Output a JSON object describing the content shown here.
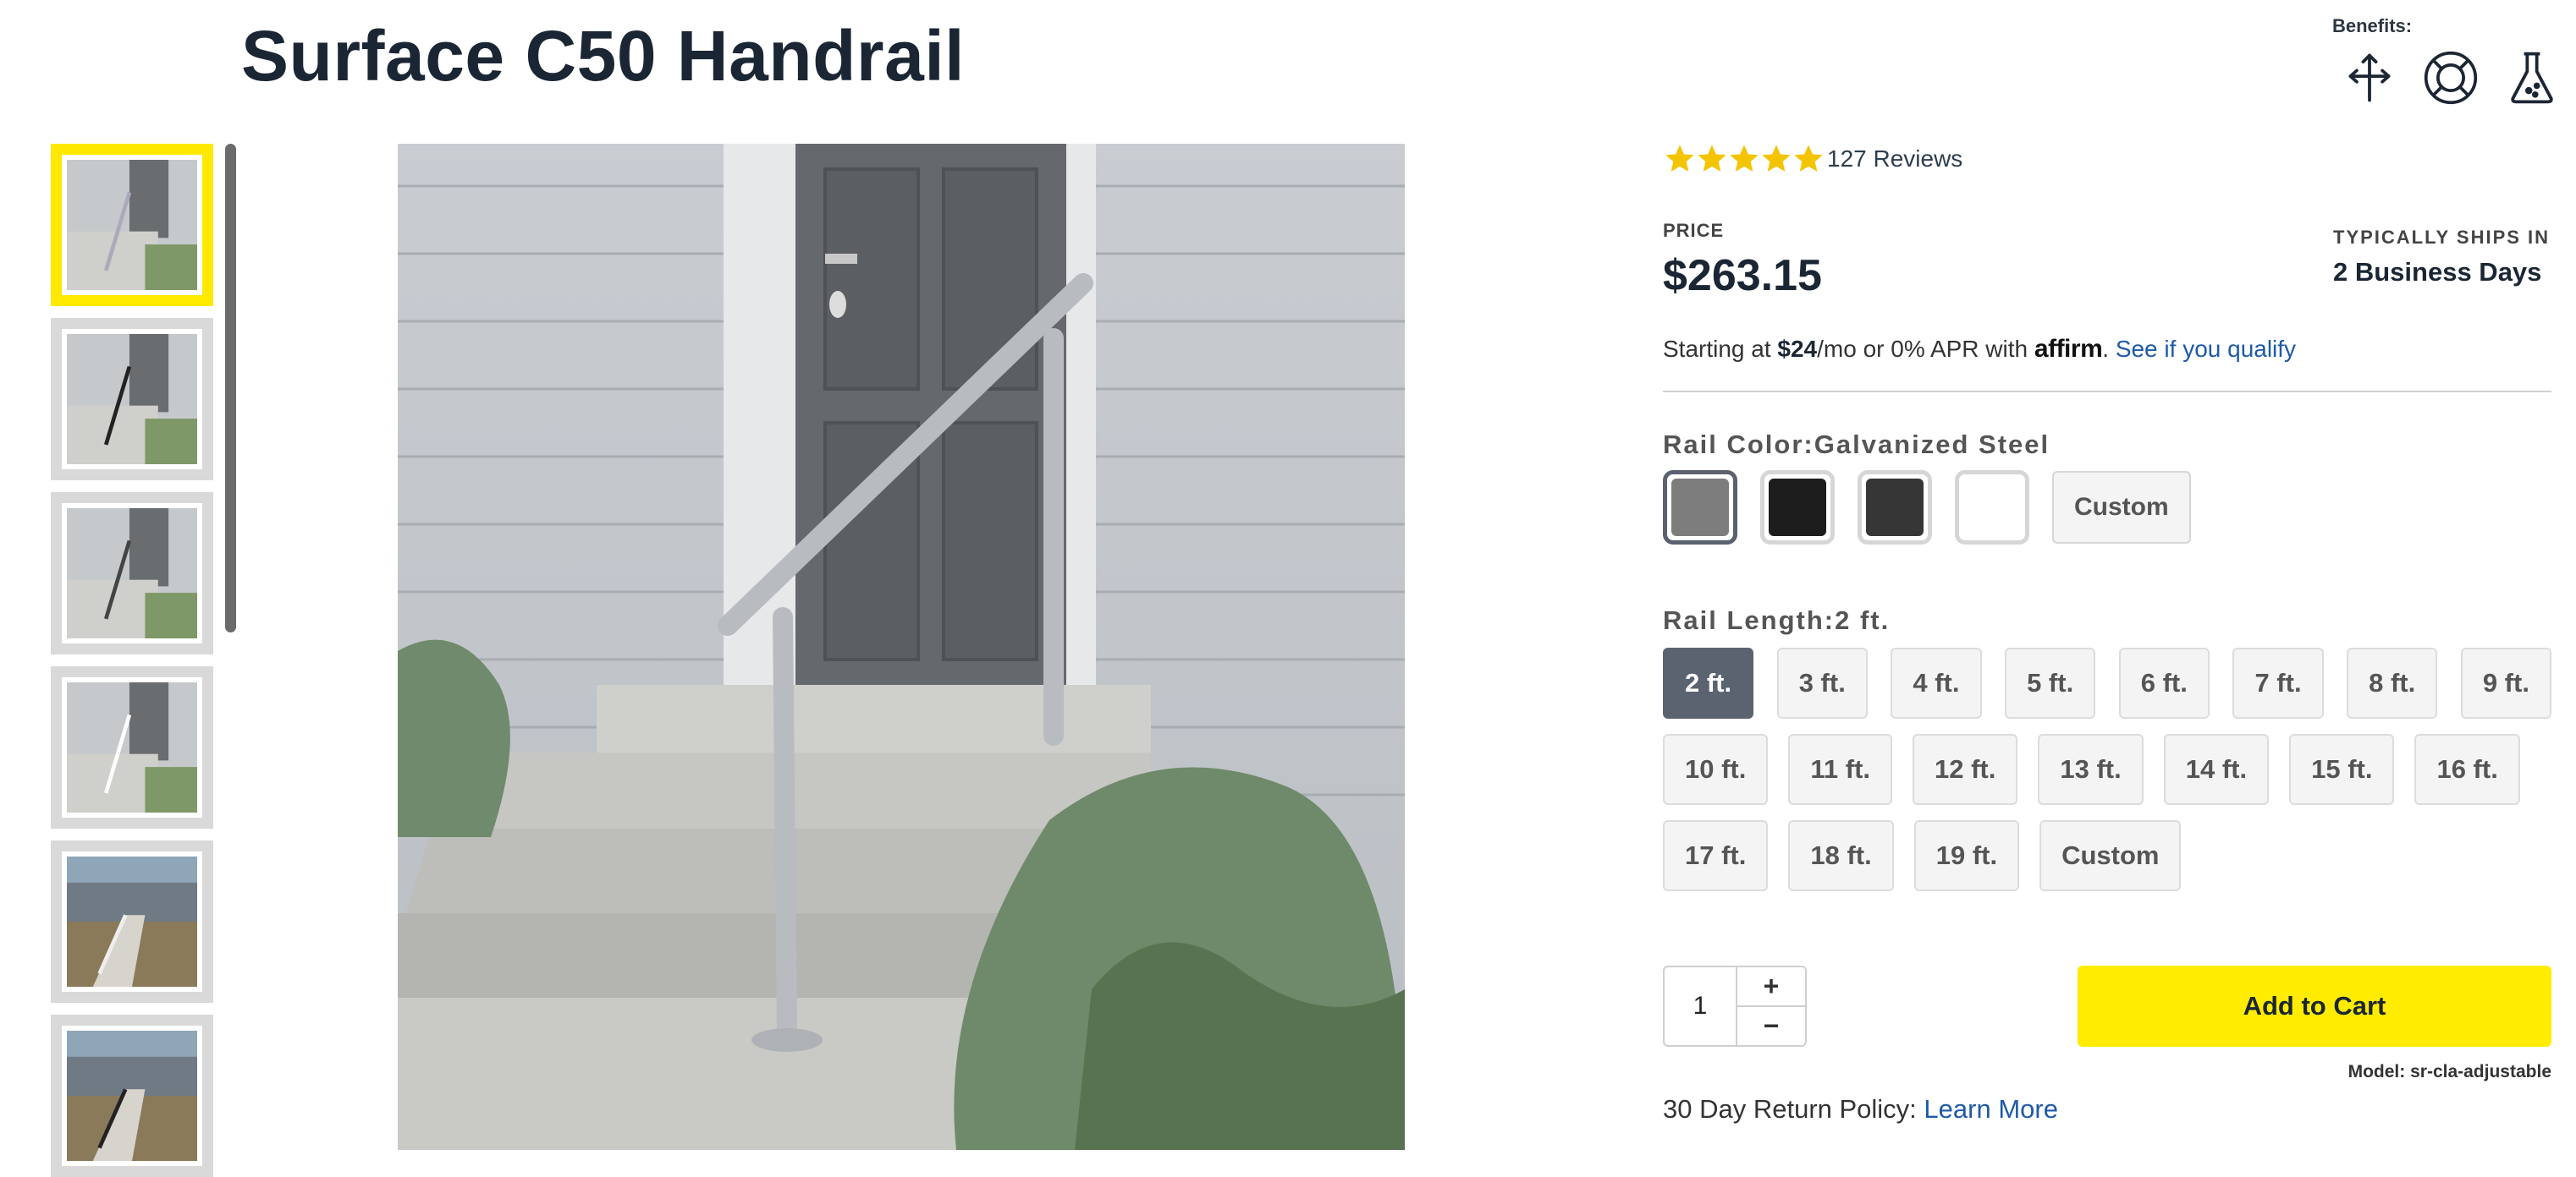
{
  "product": {
    "title": "Surface C50 Handrail"
  },
  "benefits": {
    "label": "Benefits:",
    "icons": [
      "adjustable-arrows-icon",
      "lifebuoy-icon",
      "flask-icon"
    ]
  },
  "gallery": {
    "thumbnail_count": 6,
    "selected_index": 0
  },
  "rating": {
    "stars": 5,
    "reviews_label": "127 Reviews"
  },
  "price": {
    "label": "PRICE",
    "value": "$263.15"
  },
  "shipping": {
    "label": "TYPICALLY SHIPS IN",
    "value": "2 Business Days"
  },
  "financing": {
    "prefix": "Starting at ",
    "amount": "$24",
    "suffix": "/mo or 0% APR with ",
    "brand": "affirm",
    "period": ".",
    "link": "See if you qualify"
  },
  "rail_color": {
    "label": "Rail Color:",
    "selected": "Galvanized Steel",
    "swatches": [
      {
        "color": "#7d7d7d",
        "selected": true
      },
      {
        "color": "#1d1d1d",
        "selected": false
      },
      {
        "color": "#363636",
        "selected": false
      },
      {
        "color": "#ffffff",
        "selected": false
      }
    ],
    "custom_label": "Custom"
  },
  "rail_length": {
    "label": "Rail Length:",
    "selected": "2 ft.",
    "rows": [
      [
        "2 ft.",
        "3 ft.",
        "4 ft.",
        "5 ft.",
        "6 ft.",
        "7 ft.",
        "8 ft.",
        "9 ft."
      ],
      [
        "10 ft.",
        "11 ft.",
        "12 ft.",
        "13 ft.",
        "14 ft.",
        "15 ft.",
        "16 ft."
      ],
      [
        "17 ft.",
        "18 ft.",
        "19 ft.",
        "Custom"
      ]
    ]
  },
  "cart": {
    "quantity": "1",
    "plus": "+",
    "minus": "−",
    "add_label": "Add to Cart",
    "model": "Model: sr-cla-adjustable"
  },
  "returns": {
    "text": "30 Day Return Policy: ",
    "link": "Learn More"
  },
  "colors": {
    "accent_yellow": "#ffec00",
    "link_blue": "#1e5aa8",
    "selected_length": "#5b6370"
  }
}
